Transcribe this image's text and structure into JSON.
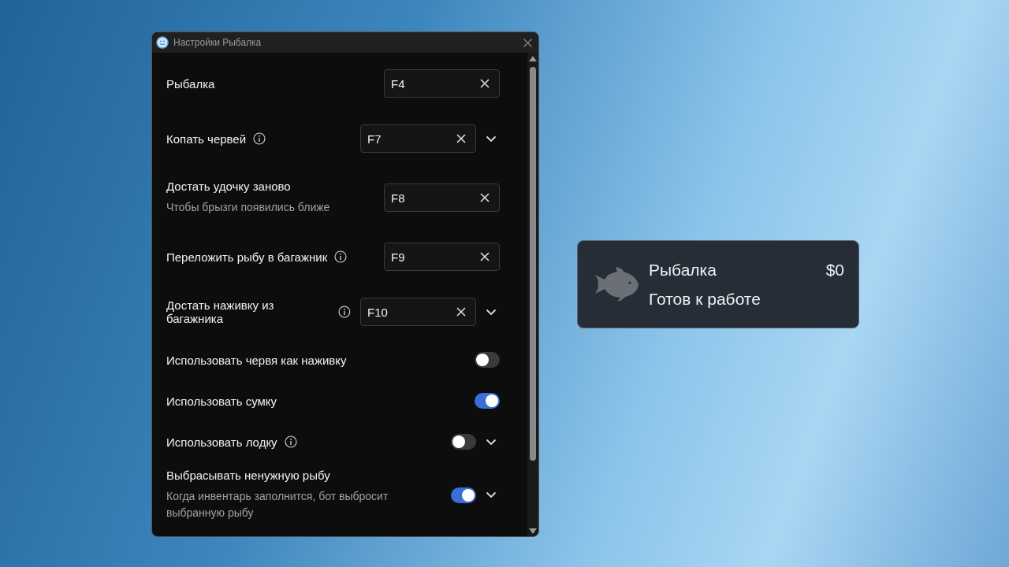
{
  "window": {
    "title": "Настройки Рыбалка"
  },
  "settings": [
    {
      "kind": "hotkey",
      "label": "Рыбалка",
      "info": false,
      "expandable": false,
      "value": "F4"
    },
    {
      "kind": "hotkey",
      "label": "Копать червей",
      "info": true,
      "expandable": true,
      "value": "F7"
    },
    {
      "kind": "hotkey",
      "label": "Достать удочку заново",
      "description": "Чтобы брызги появились ближе",
      "info": false,
      "expandable": false,
      "value": "F8"
    },
    {
      "kind": "hotkey",
      "label": "Переложить рыбу в багажник",
      "info": true,
      "expandable": false,
      "value": "F9"
    },
    {
      "kind": "hotkey",
      "label": "Достать наживку из багажника",
      "info": true,
      "expandable": true,
      "value": "F10"
    },
    {
      "kind": "toggle",
      "label": "Использовать червя как наживку",
      "info": false,
      "expandable": false,
      "on": false
    },
    {
      "kind": "toggle",
      "label": "Использовать сумку",
      "info": false,
      "expandable": false,
      "on": true
    },
    {
      "kind": "toggle",
      "label": "Использовать лодку",
      "info": true,
      "expandable": true,
      "on": false
    },
    {
      "kind": "toggle",
      "label": "Выбрасывать ненужную рыбу",
      "description": "Когда инвентарь заполнится, бот выбросит выбранную рыбу",
      "info": false,
      "expandable": true,
      "on": true
    }
  ],
  "status_card": {
    "title": "Рыбалка",
    "amount": "$0",
    "status": "Готов к работе"
  }
}
